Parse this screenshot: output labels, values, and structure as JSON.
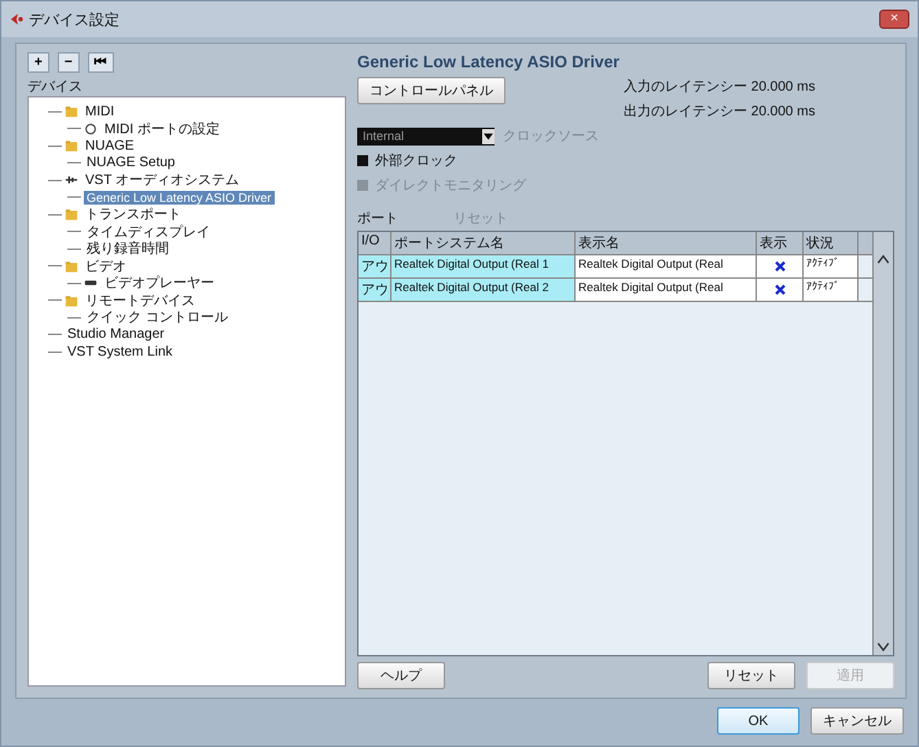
{
  "window": {
    "title": "デバイス設定",
    "close": "×"
  },
  "toolbar": [
    "+",
    "−",
    "⏮"
  ],
  "tree": {
    "heading": "デバイス",
    "items": [
      {
        "label": "MIDI",
        "kind": "folder",
        "selected": false,
        "children": [
          {
            "label": "MIDI ポートの設定",
            "kind": "port",
            "selected": false
          }
        ]
      },
      {
        "label": "NUAGE",
        "kind": "folder",
        "selected": false,
        "children": [
          {
            "label": "NUAGE Setup",
            "kind": "plain",
            "selected": false
          }
        ]
      },
      {
        "label": "VST オーディオシステム",
        "kind": "audio",
        "selected": false,
        "children": [
          {
            "label": "Generic Low Latency ASIO Driver",
            "kind": "plain",
            "selected": true
          }
        ]
      },
      {
        "label": "トランスポート",
        "kind": "folder",
        "selected": false,
        "children": [
          {
            "label": "タイムディスプレイ",
            "kind": "plain",
            "selected": false
          },
          {
            "label": "残り録音時間",
            "kind": "plain",
            "selected": false
          }
        ]
      },
      {
        "label": "ビデオ",
        "kind": "folder",
        "selected": false,
        "children": [
          {
            "label": "ビデオプレーヤー",
            "kind": "video",
            "selected": false
          }
        ]
      },
      {
        "label": "リモートデバイス",
        "kind": "folder",
        "selected": false,
        "children": [
          {
            "label": "クイック コントロール",
            "kind": "plain",
            "selected": false
          }
        ]
      },
      {
        "label": "Studio Manager",
        "kind": "plain",
        "selected": false
      },
      {
        "label": "VST System Link",
        "kind": "plain",
        "selected": false
      }
    ]
  },
  "driver": {
    "title": "Generic Low Latency ASIO Driver",
    "control_panel": "コントロールパネル",
    "input_latency": "入力のレイテンシー 20.000 ms",
    "output_latency": "出力のレイテンシー 20.000 ms",
    "clock_value": "Internal",
    "clock_label": "クロックソース",
    "options": [
      {
        "label": "外部クロック",
        "disabled": false
      },
      {
        "label": "ダイレクトモニタリング",
        "disabled": true
      }
    ]
  },
  "ports": {
    "label": "ポート",
    "reset_link": "リセット",
    "columns": [
      "I/O",
      "ポートシステム名",
      "表示名",
      "表示",
      "状況"
    ],
    "rows": [
      {
        "io": "アウ",
        "system_name": "Realtek Digital Output (Real 1",
        "display_name": "Realtek Digital Output (Real",
        "shown": true,
        "status": "ｱｸﾃｨﾌﾞ"
      },
      {
        "io": "アウ",
        "system_name": "Realtek Digital Output (Real 2",
        "display_name": "Realtek Digital Output (Real",
        "shown": true,
        "status": "ｱｸﾃｨﾌﾞ"
      }
    ]
  },
  "buttons": [
    {
      "label": "ヘルプ",
      "disabled": false
    },
    {
      "label": "リセット",
      "disabled": false
    },
    {
      "label": "適用",
      "disabled": true
    }
  ],
  "footer": [
    {
      "label": "OK",
      "default": true
    },
    {
      "label": "キャンセル",
      "default": false
    }
  ]
}
